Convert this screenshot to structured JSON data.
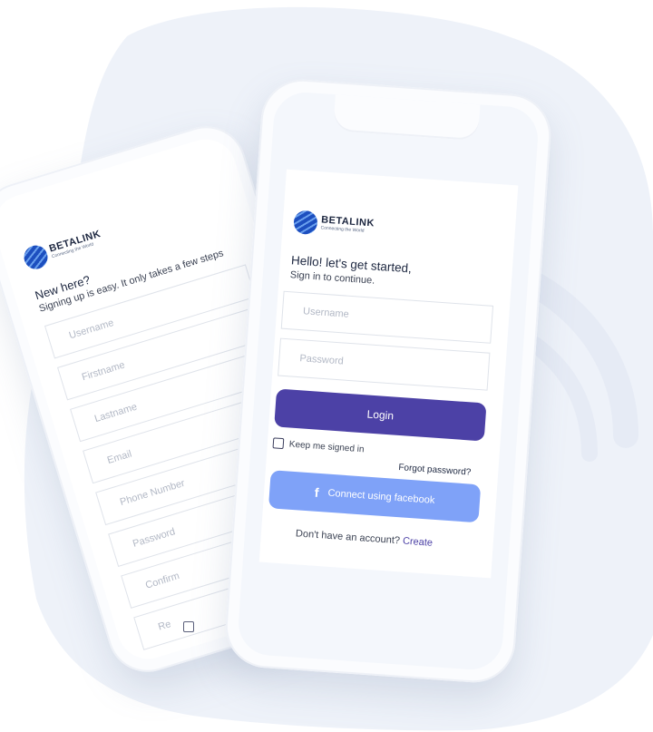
{
  "colors": {
    "accent": "#4c41a6",
    "facebook": "#7fa2f8",
    "background_blob": "#eef1f8",
    "link": "#4c41a6"
  },
  "brand": {
    "name": "BETALINK",
    "tagline": "Connecting the World"
  },
  "signup_screen": {
    "title": "New here?",
    "subtitle": "Signing up is easy. It only takes a few steps",
    "fields": [
      {
        "placeholder": "Username"
      },
      {
        "placeholder": "Firstname"
      },
      {
        "placeholder": "Lastname"
      },
      {
        "placeholder": "Email"
      },
      {
        "placeholder": "Phone Number"
      },
      {
        "placeholder": "Password"
      },
      {
        "placeholder": "Confirm"
      },
      {
        "placeholder": "Re"
      }
    ]
  },
  "login_screen": {
    "title": "Hello! let's get started,",
    "subtitle": "Sign in to continue.",
    "username_placeholder": "Username",
    "password_placeholder": "Password",
    "login_label": "Login",
    "keep_signed_in_label": "Keep me signed in",
    "forgot_password_label": "Forgot password?",
    "facebook_icon": "f",
    "facebook_label": "Connect using facebook",
    "no_account_text": "Don't have an account?",
    "create_label": "Create"
  }
}
